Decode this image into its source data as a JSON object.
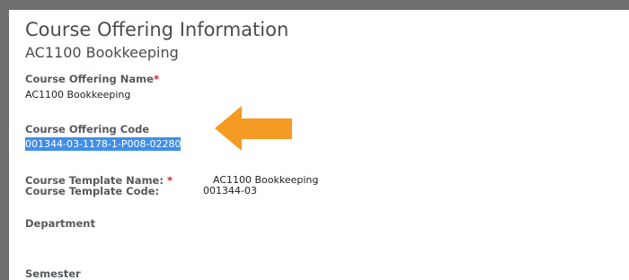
{
  "page": {
    "title": "Course Offering Information",
    "subtitle": "AC1100 Bookkeeping"
  },
  "fields": {
    "offering_name_label": "Course Offering Name",
    "offering_name_value": "AC1100 Bookkeeping",
    "offering_code_label": "Course Offering Code",
    "offering_code_value": "001344-03-1178-1-P008-02280",
    "template_name_label": "Course Template Name:",
    "template_name_value": "AC1100 Bookkeeping",
    "template_code_label": "Course Template Code:",
    "template_code_value": "001344-03",
    "department_label": "Department",
    "semester_label": "Semester",
    "required_marker": "*"
  },
  "colors": {
    "selection": "#3f8fe8",
    "arrow": "#f59a23",
    "required": "#cd2026"
  },
  "icons": {
    "annotation": "arrow-left-icon"
  }
}
